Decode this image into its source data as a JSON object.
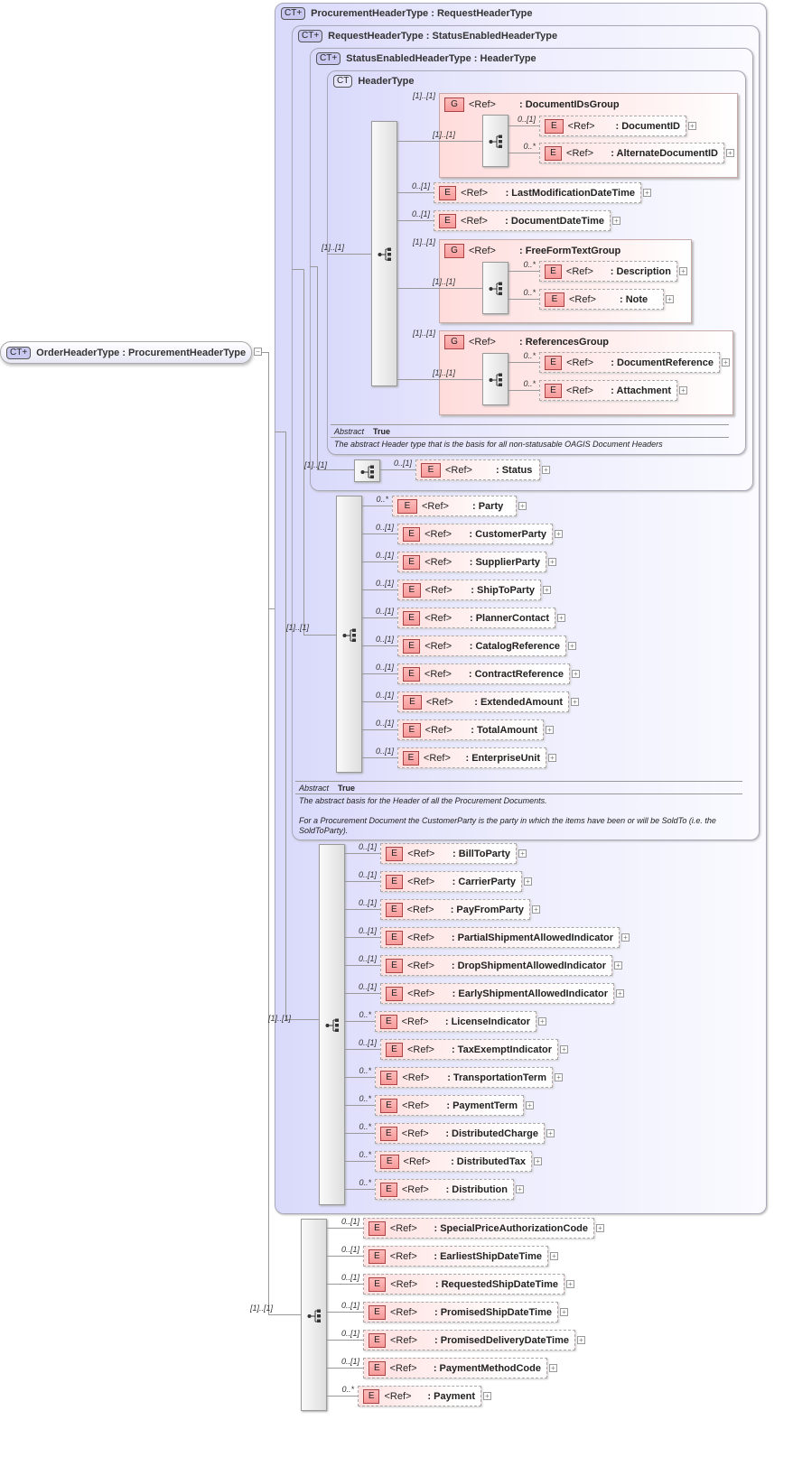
{
  "root": {
    "badge": "CT",
    "title": "OrderHeaderType : ProcurementHeaderType"
  },
  "types": [
    {
      "badge": "CT",
      "title": "ProcurementHeaderType : RequestHeaderType"
    },
    {
      "badge": "CT",
      "title": "RequestHeaderType : StatusEnabledHeaderType"
    },
    {
      "badge": "CT",
      "title": "StatusEnabledHeaderType : HeaderType"
    },
    {
      "badge": "CT",
      "title": "HeaderType"
    }
  ],
  "header_type_info": {
    "abstract_label": "Abstract",
    "abstract_value": "True",
    "description": "The abstract Header type that is the basis for all non-statusable OAGIS Document Headers"
  },
  "request_type_info": {
    "abstract_label": "Abstract",
    "abstract_value": "True",
    "description_1": "The abstract basis for the Header of all the Procurement Documents.",
    "description_2": "For a Procurement Document the CustomerParty is the party in which the items have been or will be SoldTo (i.e. the SoldToParty)."
  },
  "sequences": [
    {
      "cardinality": "[1]..[1]"
    },
    {
      "cardinality": "[1]..[1]"
    },
    {
      "cardinality": "[1]..[1]"
    },
    {
      "cardinality": "[1]..[1]"
    },
    {
      "cardinality": "[1]..[1]"
    }
  ],
  "groups": [
    {
      "badge": "G",
      "ref": "<Ref>",
      "name": ": DocumentIDsGroup",
      "cardinality": "[1]..[1]",
      "seq_cardinality": "[1]..[1]"
    },
    {
      "badge": "G",
      "ref": "<Ref>",
      "name": ": FreeFormTextGroup",
      "cardinality": "[1]..[1]",
      "seq_cardinality": "[1]..[1]"
    },
    {
      "badge": "G",
      "ref": "<Ref>",
      "name": ": ReferencesGroup",
      "cardinality": "[1]..[1]",
      "seq_cardinality": "[1]..[1]"
    }
  ],
  "element_badge": "E",
  "elements": [
    {
      "card": "0..[1]",
      "ref": "<Ref>",
      "name": ": DocumentID"
    },
    {
      "card": "0..*",
      "ref": "<Ref>",
      "name": ": AlternateDocumentID"
    },
    {
      "card": "0..[1]",
      "ref": "<Ref>",
      "name": ": LastModificationDateTime"
    },
    {
      "card": "0..[1]",
      "ref": "<Ref>",
      "name": ": DocumentDateTime"
    },
    {
      "card": "0..*",
      "ref": "<Ref>",
      "name": ": Description"
    },
    {
      "card": "0..*",
      "ref": "<Ref>",
      "name": ": Note"
    },
    {
      "card": "0..*",
      "ref": "<Ref>",
      "name": ": DocumentReference"
    },
    {
      "card": "0..*",
      "ref": "<Ref>",
      "name": ": Attachment"
    },
    {
      "card": "0..[1]",
      "ref": "<Ref>",
      "name": ": Status"
    },
    {
      "card": "0..*",
      "ref": "<Ref>",
      "name": ": Party"
    },
    {
      "card": "0..[1]",
      "ref": "<Ref>",
      "name": ": CustomerParty"
    },
    {
      "card": "0..[1]",
      "ref": "<Ref>",
      "name": ": SupplierParty"
    },
    {
      "card": "0..[1]",
      "ref": "<Ref>",
      "name": ": ShipToParty"
    },
    {
      "card": "0..[1]",
      "ref": "<Ref>",
      "name": ": PlannerContact"
    },
    {
      "card": "0..[1]",
      "ref": "<Ref>",
      "name": ": CatalogReference"
    },
    {
      "card": "0..[1]",
      "ref": "<Ref>",
      "name": ": ContractReference"
    },
    {
      "card": "0..[1]",
      "ref": "<Ref>",
      "name": ": ExtendedAmount"
    },
    {
      "card": "0..[1]",
      "ref": "<Ref>",
      "name": ": TotalAmount"
    },
    {
      "card": "0..[1]",
      "ref": "<Ref>",
      "name": ": EnterpriseUnit"
    },
    {
      "card": "0..[1]",
      "ref": "<Ref>",
      "name": ": BillToParty"
    },
    {
      "card": "0..[1]",
      "ref": "<Ref>",
      "name": ": CarrierParty"
    },
    {
      "card": "0..[1]",
      "ref": "<Ref>",
      "name": ": PayFromParty"
    },
    {
      "card": "0..[1]",
      "ref": "<Ref>",
      "name": ": PartialShipmentAllowedIndicator"
    },
    {
      "card": "0..[1]",
      "ref": "<Ref>",
      "name": ": DropShipmentAllowedIndicator"
    },
    {
      "card": "0..[1]",
      "ref": "<Ref>",
      "name": ": EarlyShipmentAllowedIndicator"
    },
    {
      "card": "0..*",
      "ref": "<Ref>",
      "name": ": LicenseIndicator"
    },
    {
      "card": "0..[1]",
      "ref": "<Ref>",
      "name": ": TaxExemptIndicator"
    },
    {
      "card": "0..*",
      "ref": "<Ref>",
      "name": ": TransportationTerm"
    },
    {
      "card": "0..*",
      "ref": "<Ref>",
      "name": ": PaymentTerm"
    },
    {
      "card": "0..*",
      "ref": "<Ref>",
      "name": ": DistributedCharge"
    },
    {
      "card": "0..*",
      "ref": "<Ref>",
      "name": ": DistributedTax"
    },
    {
      "card": "0..*",
      "ref": "<Ref>",
      "name": ": Distribution"
    },
    {
      "card": "0..[1]",
      "ref": "<Ref>",
      "name": ": SpecialPriceAuthorizationCode"
    },
    {
      "card": "0..[1]",
      "ref": "<Ref>",
      "name": ": EarliestShipDateTime"
    },
    {
      "card": "0..[1]",
      "ref": "<Ref>",
      "name": ": RequestedShipDateTime"
    },
    {
      "card": "0..[1]",
      "ref": "<Ref>",
      "name": ": PromisedShipDateTime"
    },
    {
      "card": "0..[1]",
      "ref": "<Ref>",
      "name": ": PromisedDeliveryDateTime"
    },
    {
      "card": "0..[1]",
      "ref": "<Ref>",
      "name": ": PaymentMethodCode"
    },
    {
      "card": "0..*",
      "ref": "<Ref>",
      "name": ": Payment"
    }
  ]
}
